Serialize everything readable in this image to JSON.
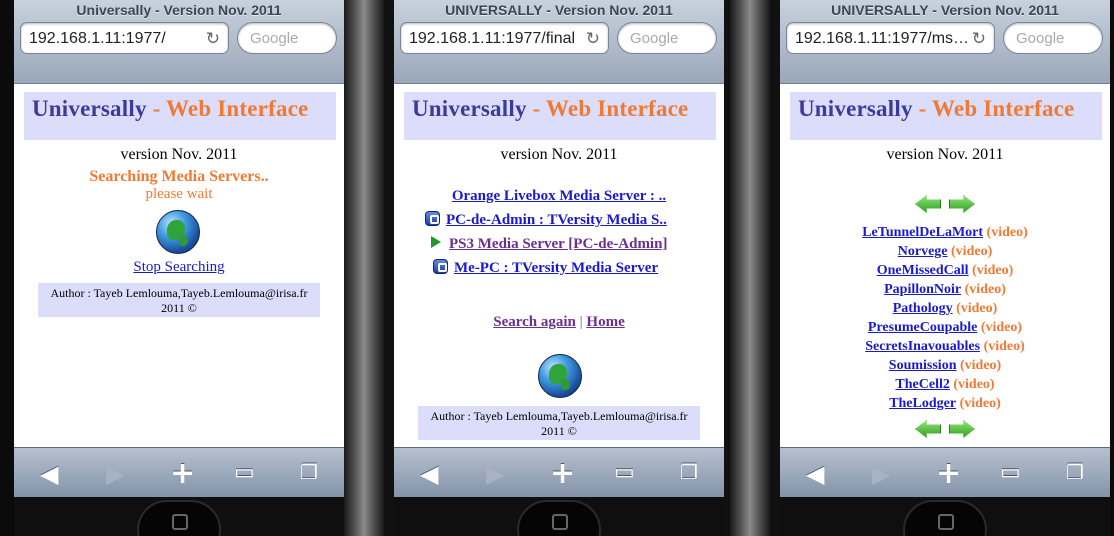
{
  "screen1": {
    "window_title": "Universally - Version Nov. 2011",
    "url": "192.168.1.11:1977/",
    "search_placeholder": "Google",
    "header_part1": "Universally",
    "header_part2": "- Web Interface",
    "version": "version Nov. 2011",
    "status": "Searching Media Servers..",
    "wait": "please wait",
    "stop_link": "Stop Searching",
    "author_line1": "Author : Tayeb Lemlouma,Tayeb.Lemlouma@irisa.fr",
    "author_line2": "2011 ©"
  },
  "screen2": {
    "window_title": "UNIVERSALLY - Version Nov. 2011",
    "url": "192.168.1.11:1977/final",
    "search_placeholder": "Google",
    "header_part1": "Universally",
    "header_part2": "- Web Interface",
    "version": "version Nov. 2011",
    "servers": [
      "Orange Livebox Media Server : ..",
      "PC-de-Admin : TVersity Media S..",
      "PS3 Media Server [PC-de-Admin]",
      "Me-PC : TVersity Media Server"
    ],
    "search_again": "Search again",
    "separator": "|",
    "home": "Home",
    "author_line1": "Author : Tayeb Lemlouma,Tayeb.Lemlouma@irisa.fr",
    "author_line2": "2011 ©"
  },
  "screen3": {
    "window_title": "UNIVERSALLY - Version Nov. 2011",
    "url": "192.168.1.11:1977/ms…",
    "search_placeholder": "Google",
    "header_part1": "Universally",
    "header_part2": "- Web Interface",
    "version": "version Nov. 2011",
    "videos": [
      {
        "title": "LeTunnelDeLaMort",
        "type": "(video)"
      },
      {
        "title": "Norvege",
        "type": "(video)"
      },
      {
        "title": "OneMissedCall",
        "type": "(video)"
      },
      {
        "title": "PapillonNoir",
        "type": "(video)"
      },
      {
        "title": "Pathology",
        "type": "(video)"
      },
      {
        "title": "PresumeCoupable",
        "type": "(video)"
      },
      {
        "title": "SecretsInavouables",
        "type": "(video)"
      },
      {
        "title": "Soumission",
        "type": "(video)"
      },
      {
        "title": "TheCell2",
        "type": "(video)"
      },
      {
        "title": "TheLodger",
        "type": "(video)"
      }
    ]
  },
  "toolbar_icons": [
    "back-icon",
    "forward-icon",
    "add-bookmark-icon",
    "bookmarks-icon",
    "pages-icon"
  ],
  "colors": {
    "header_bg": "#dcdcfb",
    "title_blue": "#3b3c9a",
    "accent_orange": "#f07a33",
    "link_blue": "#1a1acc"
  }
}
